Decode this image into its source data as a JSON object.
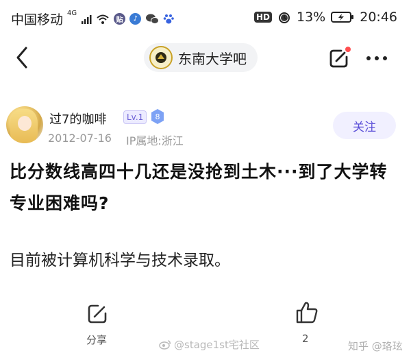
{
  "status_bar": {
    "carrier": "中国移动",
    "network": "4G",
    "battery": "13%",
    "time": "20:46",
    "hd_label": "HD"
  },
  "nav": {
    "forum_name": "东南大学吧"
  },
  "post": {
    "author": "过7的咖啡",
    "level": "Lv.1",
    "badge": "8",
    "date": "2012-07-16",
    "ip_location": "IP属地:浙江",
    "follow_label": "关注",
    "title": "比分数线高四十几还是没抢到土木···到了大学转专业困难吗?",
    "body": "目前被计算机科学与技术录取。"
  },
  "actions": {
    "share_label": "分享",
    "like_count": "2"
  },
  "watermarks": {
    "weibo": "@stage1st宅社区",
    "zhihu": "知乎 @珞玹"
  },
  "colors": {
    "accent": "#5b4fd8",
    "follow_bg": "#f1f0ff",
    "notify_dot": "#ff4d4f"
  }
}
